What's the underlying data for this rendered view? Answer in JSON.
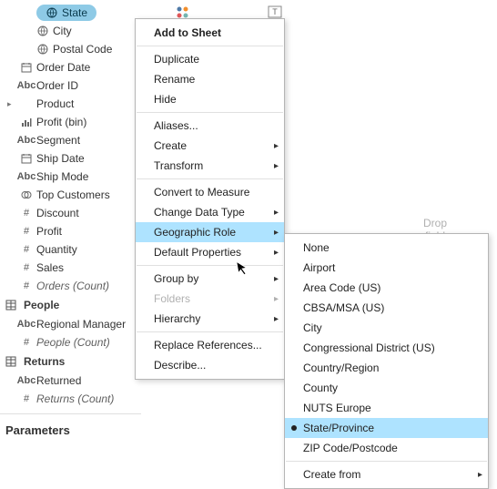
{
  "sidebar": {
    "items": [
      {
        "label": "State",
        "icon": "globe",
        "indent": 1,
        "pill": true
      },
      {
        "label": "City",
        "icon": "globe",
        "indent": 1
      },
      {
        "label": "Postal Code",
        "icon": "globe",
        "indent": 1
      },
      {
        "label": "Order Date",
        "icon": "calendar"
      },
      {
        "label": "Order ID",
        "icon": "abc"
      },
      {
        "label": "Product",
        "icon": "none",
        "expandable": true
      },
      {
        "label": "Profit (bin)",
        "icon": "bin"
      },
      {
        "label": "Segment",
        "icon": "abc"
      },
      {
        "label": "Ship Date",
        "icon": "calendar"
      },
      {
        "label": "Ship Mode",
        "icon": "abc"
      },
      {
        "label": "Top Customers",
        "icon": "set"
      },
      {
        "label": "Discount",
        "icon": "hash"
      },
      {
        "label": "Profit",
        "icon": "hash"
      },
      {
        "label": "Quantity",
        "icon": "hash"
      },
      {
        "label": "Sales",
        "icon": "hash"
      },
      {
        "label": "Orders (Count)",
        "icon": "hash",
        "italic": true
      }
    ],
    "groups": [
      {
        "label": "People",
        "items": [
          {
            "label": "Regional Manager",
            "icon": "abc"
          },
          {
            "label": "People (Count)",
            "icon": "hash",
            "italic": true
          }
        ]
      },
      {
        "label": "Returns",
        "items": [
          {
            "label": "Returned",
            "icon": "abc"
          },
          {
            "label": "Returns (Count)",
            "icon": "hash",
            "italic": true
          }
        ]
      }
    ],
    "parameters_header": "Parameters"
  },
  "toolbar": {
    "text_label": "Text"
  },
  "drop": {
    "line1": "Drop",
    "line2": "field"
  },
  "ctx1": {
    "items": [
      {
        "label": "Add to Sheet",
        "bold": true
      },
      {
        "sep": true
      },
      {
        "label": "Duplicate"
      },
      {
        "label": "Rename"
      },
      {
        "label": "Hide"
      },
      {
        "sep": true
      },
      {
        "label": "Aliases..."
      },
      {
        "label": "Create",
        "submenu": true
      },
      {
        "label": "Transform",
        "submenu": true
      },
      {
        "sep": true
      },
      {
        "label": "Convert to Measure"
      },
      {
        "label": "Change Data Type",
        "submenu": true
      },
      {
        "label": "Geographic Role",
        "submenu": true,
        "highlight": true
      },
      {
        "label": "Default Properties",
        "submenu": true
      },
      {
        "sep": true
      },
      {
        "label": "Group by",
        "submenu": true
      },
      {
        "label": "Folders",
        "submenu": true,
        "disabled": true
      },
      {
        "label": "Hierarchy",
        "submenu": true
      },
      {
        "sep": true
      },
      {
        "label": "Replace References..."
      },
      {
        "label": "Describe..."
      }
    ]
  },
  "ctx2": {
    "items": [
      {
        "label": "None"
      },
      {
        "label": "Airport"
      },
      {
        "label": "Area Code (US)"
      },
      {
        "label": "CBSA/MSA (US)"
      },
      {
        "label": "City"
      },
      {
        "label": "Congressional District (US)"
      },
      {
        "label": "Country/Region"
      },
      {
        "label": "County"
      },
      {
        "label": "NUTS Europe"
      },
      {
        "label": "State/Province",
        "bullet": true,
        "highlight": true
      },
      {
        "label": "ZIP Code/Postcode"
      },
      {
        "sep": true
      },
      {
        "label": "Create from",
        "submenu": true
      }
    ]
  }
}
